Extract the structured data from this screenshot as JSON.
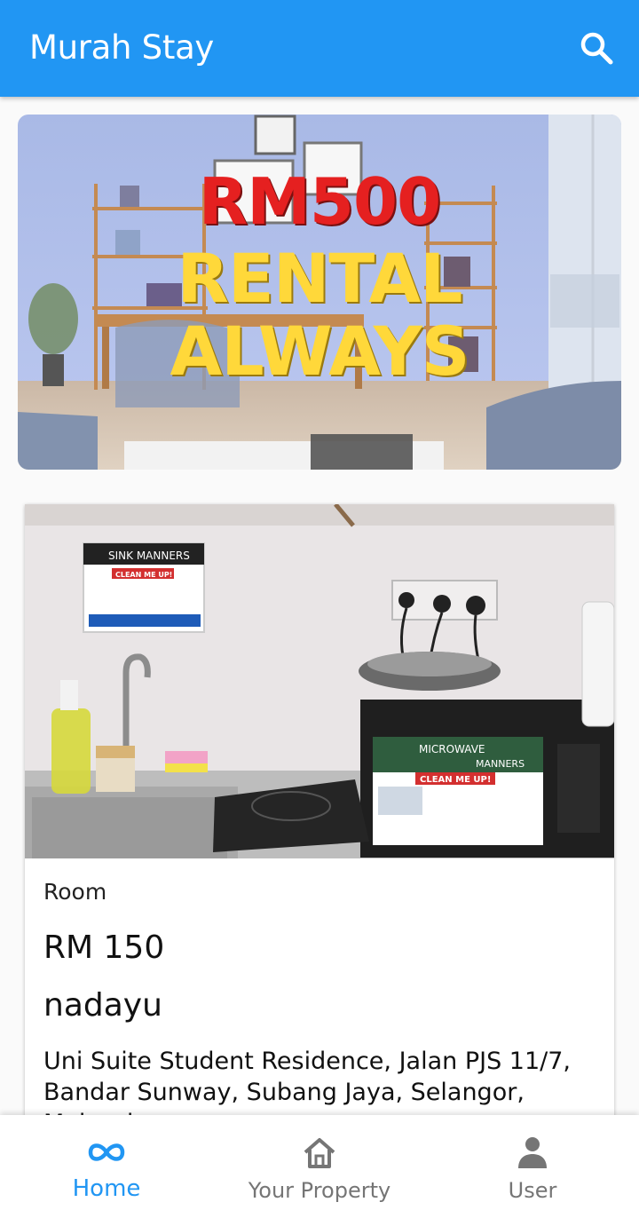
{
  "app_bar": {
    "title": "Murah Stay",
    "search_icon": "search-icon"
  },
  "banner": {
    "line1": "RM500",
    "line2": "RENTAL",
    "line3": "ALWAYS"
  },
  "listing": {
    "type": "Room",
    "price": "RM 150",
    "owner": "nadayu",
    "address": "Uni Suite Student Residence, Jalan PJS 11/7, Bandar Sunway, Subang Jaya, Selangor, Malaysia",
    "photo_signs": {
      "sink_title": "SINK MANNERS",
      "sink_sub": "CLEAN ME UP!",
      "micro_title": "MICROWAVE",
      "micro_title2": "MANNERS",
      "micro_sub": "CLEAN ME UP!"
    }
  },
  "bottom_nav": {
    "items": [
      {
        "label": "Home",
        "icon": "infinity-icon",
        "active": true
      },
      {
        "label": "Your Property",
        "icon": "home-icon",
        "active": false
      },
      {
        "label": "User",
        "icon": "person-icon",
        "active": false
      }
    ]
  },
  "colors": {
    "primary": "#2196f3",
    "inactive": "#757575"
  }
}
